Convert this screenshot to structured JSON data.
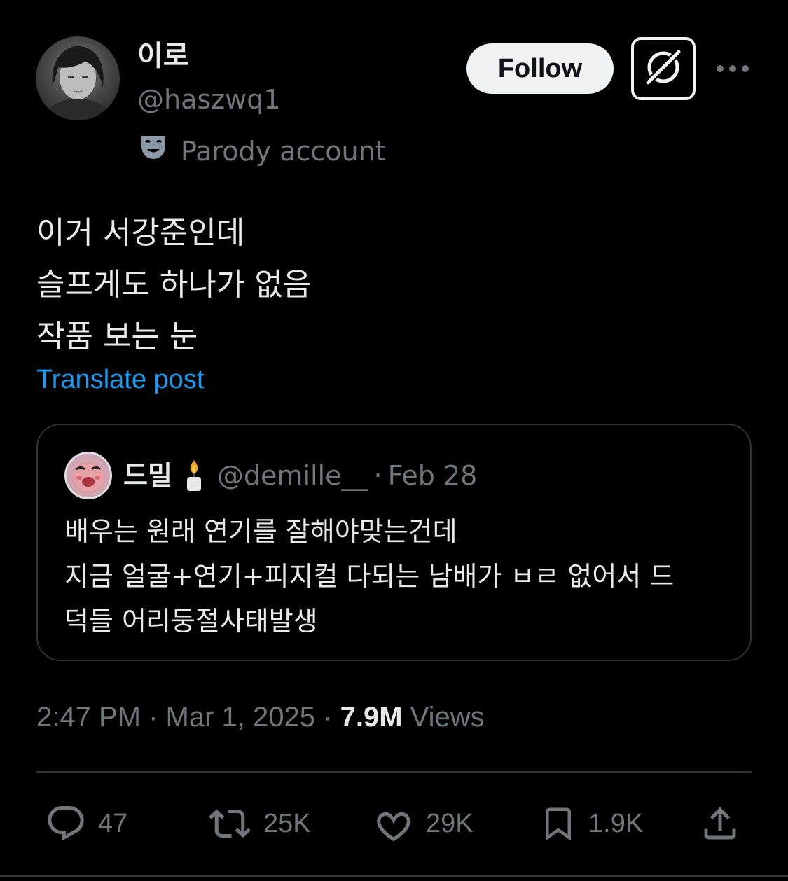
{
  "author": {
    "display_name": "이로",
    "handle": "@haszwq1",
    "parody_label": "Parody account"
  },
  "header": {
    "follow_label": "Follow"
  },
  "post": {
    "lines": [
      "이거 서강준인데",
      "슬프게도 하나가 없음",
      "작품 보는 눈"
    ],
    "translate_label": "Translate post"
  },
  "quote": {
    "display_name": "드밀",
    "handle": "@demille__",
    "separator": "·",
    "date": "Feb 28",
    "lines": [
      "배우는 원래 연기를 잘해야맞는건데",
      "지금 얼굴+연기+피지컬 다되는 남배가 ㅂㄹ 없어서 드",
      "덕들 어리둥절사태발생"
    ]
  },
  "meta": {
    "time": "2:47 PM",
    "separator": "·",
    "date": "Mar 1, 2025",
    "views_count": "7.9M",
    "views_label": "Views"
  },
  "actions": {
    "replies": "47",
    "reposts": "25K",
    "likes": "29K",
    "bookmarks": "1.9K"
  },
  "colors": {
    "background": "#000000",
    "text_primary": "#e7e9ea",
    "text_secondary": "#71767b",
    "link": "#1d9bf0",
    "border": "#2f3336"
  },
  "icons": [
    "grok-icon",
    "more-icon",
    "parody-mask-icon",
    "candle-icon",
    "reply-icon",
    "repost-icon",
    "like-icon",
    "bookmark-icon",
    "share-icon"
  ]
}
